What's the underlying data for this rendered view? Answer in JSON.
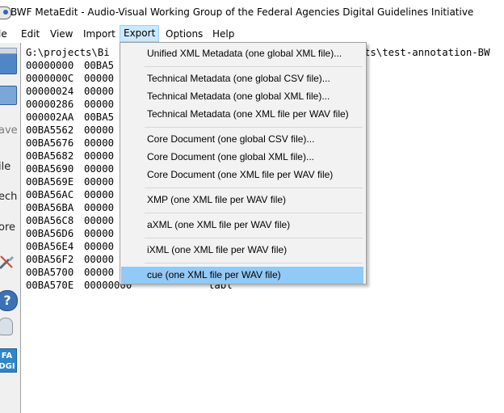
{
  "window": {
    "title": "BWF MetaEdit - Audio-Visual Working Group of the Federal Agencies Digital Guidelines Initiative"
  },
  "menubar": {
    "items": [
      {
        "label": "le"
      },
      {
        "label": "Edit"
      },
      {
        "label": "View"
      },
      {
        "label": "Import"
      },
      {
        "label": "Export"
      },
      {
        "label": "Options"
      },
      {
        "label": "Help"
      }
    ]
  },
  "toolbar": {
    "save_label": "ave",
    "file_label": "ile",
    "tech_label": "ech",
    "core_label": "ore",
    "help_glyph": "?",
    "fadgi_label": "FA\nDGI"
  },
  "content": {
    "path_left": "G:\\projects\\Bi",
    "path_right": "ts\\test-annotation-BW",
    "rows": [
      {
        "offset": "00000000",
        "col2": "00BA5",
        "col3": ""
      },
      {
        "offset": "0000000C",
        "col2": "00000",
        "col3": ""
      },
      {
        "offset": "00000024",
        "col2": "00000",
        "col3": ""
      },
      {
        "offset": "00000286",
        "col2": "00000",
        "col3": ""
      },
      {
        "offset": "000002AA",
        "col2": "00BA5",
        "col3": ""
      },
      {
        "offset": "00BA5562",
        "col2": "00000",
        "col3": ""
      },
      {
        "offset": "00BA5676",
        "col2": "00000",
        "col3": ""
      },
      {
        "offset": "00BA5682",
        "col2": "00000",
        "col3": ""
      },
      {
        "offset": "00BA5690",
        "col2": "00000",
        "col3": ""
      },
      {
        "offset": "00BA569E",
        "col2": "00000",
        "col3": ""
      },
      {
        "offset": "00BA56AC",
        "col2": "00000",
        "col3": ""
      },
      {
        "offset": "00BA56BA",
        "col2": "00000",
        "col3": ""
      },
      {
        "offset": "00BA56C8",
        "col2": "00000",
        "col3": ""
      },
      {
        "offset": "00BA56D6",
        "col2": "00000",
        "col3": ""
      },
      {
        "offset": "00BA56E4",
        "col2": "00000",
        "col3": ""
      },
      {
        "offset": "00BA56F2",
        "col2": "00000",
        "col3": ""
      },
      {
        "offset": "00BA5700",
        "col2": "00000",
        "col3": ""
      },
      {
        "offset": "00BA570E",
        "col2": "00000000",
        "col3": "labl"
      }
    ]
  },
  "export_menu": {
    "items": [
      {
        "label": "Unified XML Metadata (one global XML file)...",
        "highlighted": false
      },
      {
        "label": "Technical Metadata (one global CSV file)...",
        "highlighted": false
      },
      {
        "label": "Technical Metadata (one global XML file)...",
        "highlighted": false
      },
      {
        "label": "Technical Metadata (one XML file per WAV file)",
        "highlighted": false
      },
      {
        "label": "Core Document (one global CSV file)...",
        "highlighted": false
      },
      {
        "label": "Core Document (one global XML file)...",
        "highlighted": false
      },
      {
        "label": "Core Document (one XML file per WAV file)",
        "highlighted": false
      },
      {
        "label": "XMP (one XML file per WAV file)",
        "highlighted": false
      },
      {
        "label": "aXML (one XML file per WAV file)",
        "highlighted": false
      },
      {
        "label": "iXML (one XML file per WAV file)",
        "highlighted": false
      },
      {
        "label": "cue (one XML file per WAV file)",
        "highlighted": true
      }
    ]
  },
  "colors": {
    "highlight": "#91c9f7",
    "menu_open": "#cce8ff",
    "menu_bg": "#f2f2f2"
  }
}
